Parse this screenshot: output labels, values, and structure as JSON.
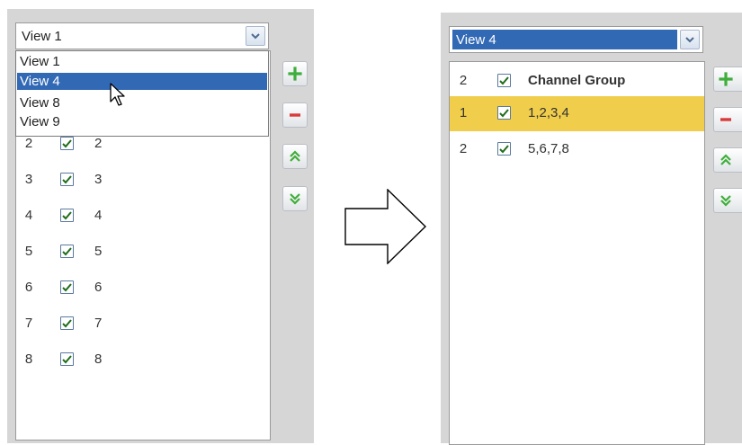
{
  "left_panel": {
    "select": {
      "value": "View 1"
    },
    "dropdown": {
      "options": [
        "View 1",
        "View 4",
        "View 8",
        "View 9"
      ],
      "highlighted": "View 4"
    },
    "rows": [
      {
        "num": "2",
        "label": "2",
        "checked": true
      },
      {
        "num": "3",
        "label": "3",
        "checked": true
      },
      {
        "num": "4",
        "label": "4",
        "checked": true
      },
      {
        "num": "5",
        "label": "5",
        "checked": true
      },
      {
        "num": "6",
        "label": "6",
        "checked": true
      },
      {
        "num": "7",
        "label": "7",
        "checked": true
      },
      {
        "num": "8",
        "label": "8",
        "checked": true
      }
    ],
    "buttons": [
      "add-icon",
      "remove-icon",
      "move-up-icon",
      "move-down-icon"
    ]
  },
  "right_panel": {
    "select": {
      "value": "View 4"
    },
    "rows": [
      {
        "num": "2",
        "label": "Channel Group",
        "checked": true,
        "header": true
      },
      {
        "num": "1",
        "label": "1,2,3,4",
        "checked": true,
        "selected": true
      },
      {
        "num": "2",
        "label": "5,6,7,8",
        "checked": true
      }
    ],
    "buttons": [
      "add-icon",
      "remove-icon",
      "move-up-icon",
      "move-down-icon"
    ]
  },
  "colors": {
    "frame": "#d6d6d6",
    "selection_blue": "#3269b5",
    "selected_row": "#f0cd4b",
    "add_green": "#3fae3a",
    "remove_red": "#d93b3b"
  }
}
